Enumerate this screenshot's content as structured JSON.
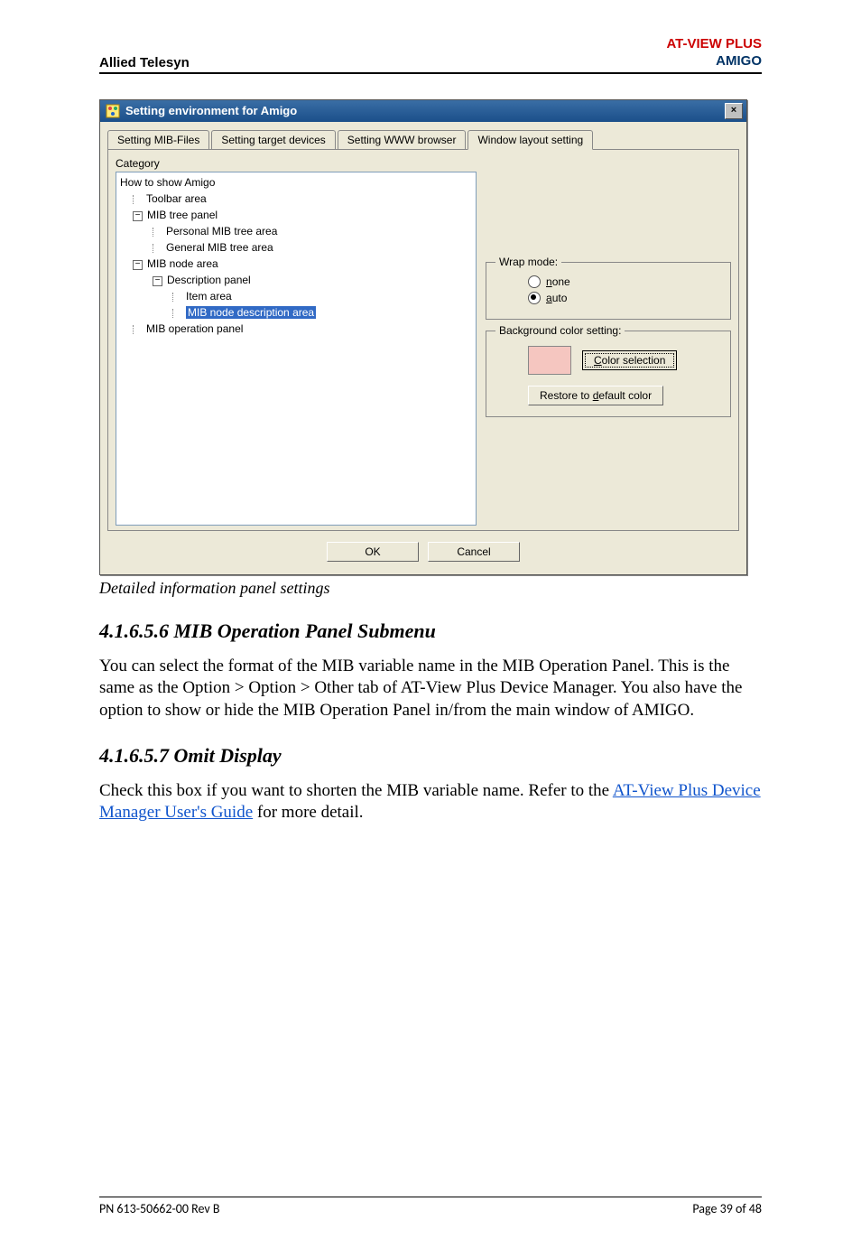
{
  "header": {
    "left": "Allied Telesyn",
    "brand": "AT-VIEW PLUS",
    "product": "AMIGO"
  },
  "dialog": {
    "title": "Setting environment for Amigo",
    "close": "×",
    "tabs": [
      "Setting MIB-Files",
      "Setting target devices",
      "Setting WWW browser",
      "Window layout setting"
    ],
    "active_tab": 3,
    "category_label": "Category",
    "tree": {
      "root": "How to show Amigo",
      "n1": "Toolbar area",
      "n2": "MIB tree panel",
      "n2a": "Personal MIB tree area",
      "n2b": "General MIB tree area",
      "n3": "MIB node area",
      "n3a": "Description panel",
      "n3a1": "Item area",
      "n3a2": "MIB node description area",
      "n4": "MIB operation panel"
    },
    "wrap": {
      "legend": "Wrap mode:",
      "none": "none",
      "auto": "auto",
      "none_prefix": "n",
      "auto_prefix": "a"
    },
    "bg": {
      "legend": "Background color setting:",
      "color_btn": "Color selection",
      "restore_btn": "Restore to default color",
      "color_u": "C",
      "restore_u": "d",
      "swatch_hex": "#f5c6c0"
    },
    "ok": "OK",
    "cancel": "Cancel"
  },
  "caption": "Detailed information panel settings",
  "sec1": {
    "h": "4.1.6.5.6 MIB Operation Panel Submenu",
    "p": "You can select the format of the MIB variable name in the MIB Operation Panel. This is the same as the Option > Option > Other tab of AT-View Plus Device Manager. You also have the option to show or hide the MIB Operation Panel in/from the main window of AMIGO."
  },
  "sec2": {
    "h": "4.1.6.5.7 Omit Display",
    "p1": "Check this box if you want to shorten the MIB variable name. Refer to the ",
    "link": "AT-View Plus Device Manager User's Guide",
    "p2": " for more detail."
  },
  "footer": {
    "left": "PN 613-50662-00 Rev B",
    "right": "Page 39 of 48"
  }
}
